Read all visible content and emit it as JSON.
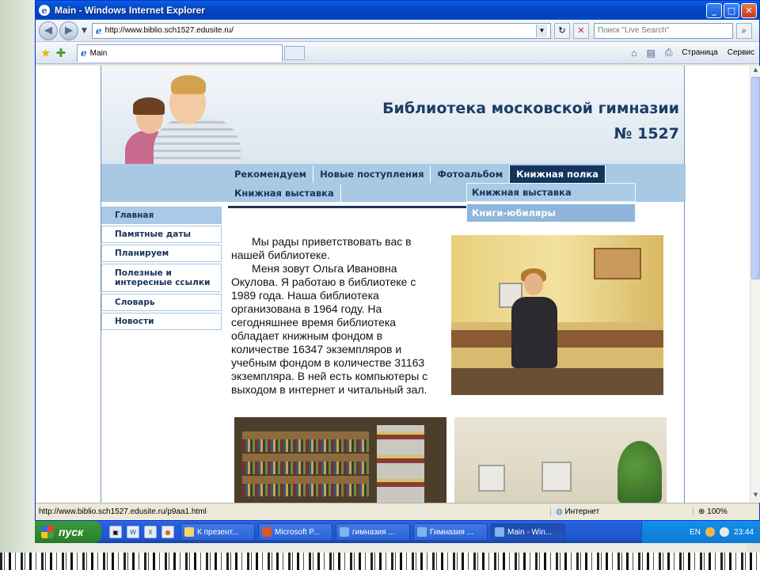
{
  "window": {
    "title": "Main - Windows Internet Explorer",
    "buttons": {
      "minimize": "_",
      "maximize": "□",
      "close": "✕"
    }
  },
  "address_bar": {
    "url": "http://www.biblio.sch1527.edusite.ru/",
    "search_placeholder": "Поиск \"Live Search\""
  },
  "tabs": [
    {
      "label": "Main"
    }
  ],
  "command_bar": {
    "page_label": "Страница",
    "tools_label": "Сервис"
  },
  "site": {
    "title_line1": "Библиотека московской гимназии",
    "title_line2": "№ 1527",
    "top_menu": [
      "Рекомендуем",
      "Новые поступления",
      "Фотоальбом",
      "Книжная полка"
    ],
    "top_menu_row2": [
      "Книжная выставка"
    ],
    "active_menu": "Книжная полка",
    "dropdown": [
      "Книжная выставка",
      "Книги-юбиляры"
    ],
    "side_menu": [
      "Главная",
      "Памятные даты",
      "Планируем",
      "Полезные и интересные ссылки",
      "Словарь",
      "Новости"
    ],
    "intro_p1": "Мы рады приветствовать вас в нашей библиотеке.",
    "intro_p2": "Меня зовут Ольга Ивановна Окулова. Я работаю  в библиотеке с 1989 года. Наша библиотека организована в 1964 году. На сегодняшнее время библиотека обладает  книжным фондом в количестве 16347 экземпляров и учебным фондом в количестве 31163 экземпляра. В ней есть компьютеры с выходом в интернет и читальный зал."
  },
  "status_bar": {
    "url": "http://www.biblio.sch1527.edusite.ru/p9aa1.html",
    "zone": "Интернет",
    "zoom": "100%"
  },
  "taskbar": {
    "start_label": "пуск",
    "tasks": [
      "К презент...",
      "Microsoft P...",
      "гимназия ...",
      "Гимназия ...",
      "Main - Win..."
    ],
    "active_task": 4,
    "lang": "EN",
    "clock": "23:44"
  }
}
